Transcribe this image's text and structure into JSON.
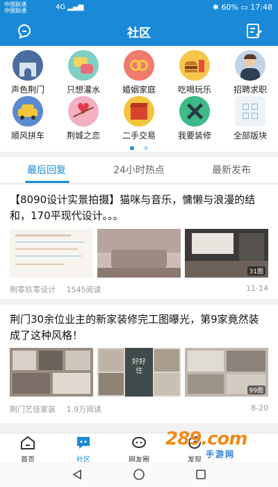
{
  "status_bar": {
    "carrier1": "中国联通",
    "carrier2": "中国联通",
    "signal": "4G",
    "battery": "60%",
    "time": "17:48"
  },
  "app_bar": {
    "title": "社区"
  },
  "categories": [
    {
      "label": "声色荆门",
      "color": "#4b6c9e"
    },
    {
      "label": "只想灌水",
      "color": "#7fd0c2"
    },
    {
      "label": "婚姻家庭",
      "color": "#f07a6b"
    },
    {
      "label": "吃喝玩乐",
      "color": "#f6c64a"
    },
    {
      "label": "招聘求职",
      "color": "#c2d3e8"
    },
    {
      "label": "顺风拼车",
      "color": "#5a8bd0"
    },
    {
      "label": "荆城之恋",
      "color": "#f3b0c0"
    },
    {
      "label": "二手交易",
      "color": "#f4c43a"
    },
    {
      "label": "我要装修",
      "color": "#3dbb88"
    },
    {
      "label": "全部版块",
      "color": "#eef3f8"
    }
  ],
  "tabs": [
    {
      "label": "最后回复",
      "active": true
    },
    {
      "label": "24小时热点",
      "active": false
    },
    {
      "label": "最新发布",
      "active": false
    }
  ],
  "posts": [
    {
      "title": "【8090设计实景拍摄】猫咪与音乐，慵懒与浪漫的结和，170平现代设计。。。",
      "author": "荆零玖零设计",
      "views": "1545阅读",
      "date": "11-14",
      "photo_count": "31图"
    },
    {
      "title": "荆门30余位业主的新家装修完工图曝光，第9家竟然装成了这种风格！",
      "author": "荆门艺佳家装",
      "views": "1.9万阅读",
      "date": "8-20",
      "photo_count": "99图",
      "sign_text": "好好住"
    }
  ],
  "bottom_nav": [
    {
      "label": "首页",
      "active": false
    },
    {
      "label": "社区",
      "active": true
    },
    {
      "label": "网友圈",
      "active": false
    },
    {
      "label": "发现",
      "active": false
    }
  ],
  "watermark": {
    "text": "289.com",
    "sub": "手游网"
  },
  "colors": {
    "brand": "#1a8ad8",
    "text": "#111111",
    "muted": "#999999"
  }
}
